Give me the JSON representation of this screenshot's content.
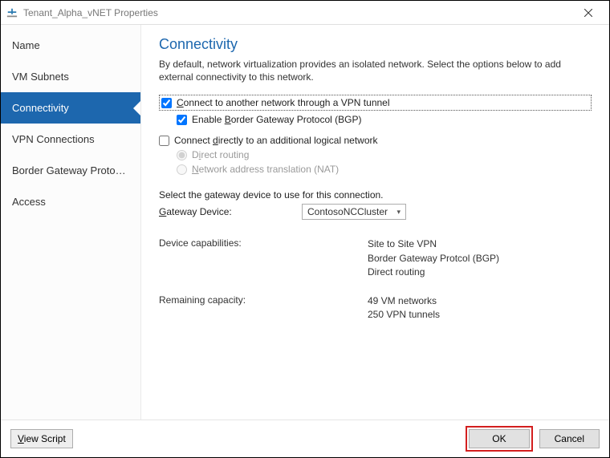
{
  "window": {
    "title": "Tenant_Alpha_vNET Properties"
  },
  "sidebar": {
    "items": [
      {
        "label": "Name"
      },
      {
        "label": "VM Subnets"
      },
      {
        "label": "Connectivity"
      },
      {
        "label": "VPN Connections"
      },
      {
        "label": "Border Gateway Protocol..."
      },
      {
        "label": "Access"
      }
    ]
  },
  "page": {
    "title": "Connectivity",
    "intro": "By default, network virtualization provides an isolated network. Select the options below to add external connectivity to this network."
  },
  "options": {
    "vpn_tunnel": {
      "label_before": "C",
      "label_after": "onnect to another network through a VPN tunnel",
      "checked": true
    },
    "enable_bgp": {
      "label_before": "Enable ",
      "label_key": "B",
      "label_after": "order Gateway Protocol (BGP)",
      "checked": true
    },
    "direct_logical": {
      "label_before": "Connect ",
      "label_key": "d",
      "label_after": "irectly to an additional logical network",
      "checked": false
    },
    "direct_routing": {
      "label_before": "D",
      "label_key": "i",
      "label_after": "rect routing",
      "selected": true,
      "disabled": true
    },
    "nat": {
      "label_before": "",
      "label_key": "N",
      "label_after": "etwork address translation (NAT)",
      "selected": false,
      "disabled": true
    }
  },
  "gateway": {
    "select_text": "Select the gateway device to use for this connection.",
    "label_before": "",
    "label_key": "G",
    "label_after": "ateway Device:",
    "selected": "ContosoNCCluster"
  },
  "info": {
    "caps_label": "Device capabilities:",
    "caps_values": "Site to Site VPN\nBorder Gateway Protcol (BGP)\nDirect routing",
    "remaining_label": "Remaining capacity:",
    "remaining_values": "49 VM networks\n250 VPN tunnels"
  },
  "footer": {
    "view_script_before": "",
    "view_script_key": "V",
    "view_script_after": "iew Script",
    "ok": "OK",
    "cancel": "Cancel"
  }
}
